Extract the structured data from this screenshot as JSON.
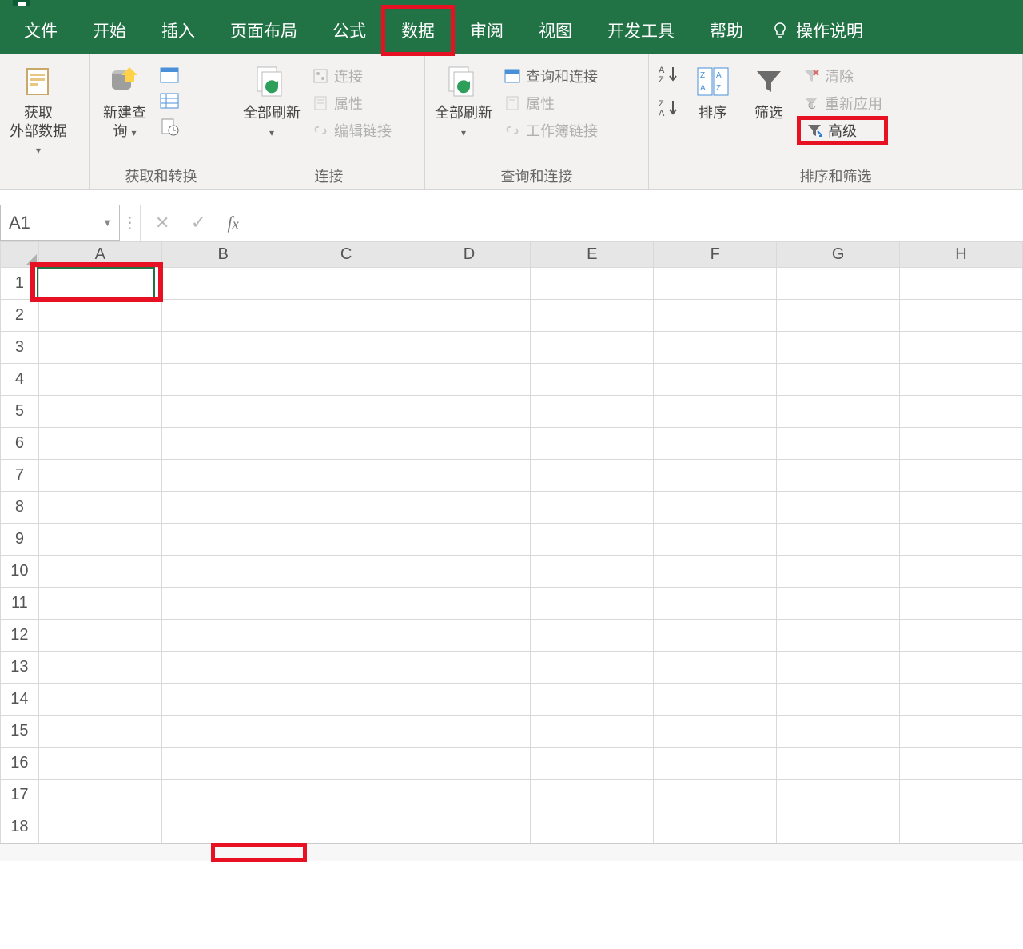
{
  "tabs": {
    "file": "文件",
    "home": "开始",
    "insert": "插入",
    "pagelayout": "页面布局",
    "formulas": "公式",
    "data": "数据",
    "review": "审阅",
    "view": "视图",
    "developer": "开发工具",
    "help": "帮助",
    "tellme": "操作说明"
  },
  "ribbon": {
    "get_external": {
      "label": "获取\n外部数据"
    },
    "new_query": {
      "label": "新建查\n询"
    },
    "group_transform": "获取和转换",
    "refresh_all": "全部刷新",
    "conn": "连接",
    "props": "属性",
    "editlinks": "编辑链接",
    "group_connections": "连接",
    "refresh_all2": "全部刷新",
    "queries_conn": "查询和连接",
    "props2": "属性",
    "wb_links": "工作簿链接",
    "group_queries": "查询和连接",
    "sort": "排序",
    "filter": "筛选",
    "clear": "清除",
    "reapply": "重新应用",
    "advanced": "高级",
    "group_sortfilter": "排序和筛选"
  },
  "namebox": "A1",
  "columns": [
    "A",
    "B",
    "C",
    "D",
    "E",
    "F",
    "G",
    "H"
  ],
  "rows": [
    "1",
    "2",
    "3",
    "4",
    "5",
    "6",
    "7",
    "8",
    "9",
    "10",
    "11",
    "12",
    "13",
    "14",
    "15",
    "16",
    "17",
    "18"
  ]
}
